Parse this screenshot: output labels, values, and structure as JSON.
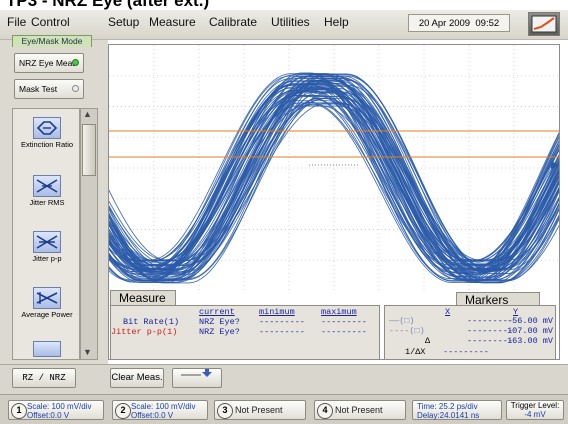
{
  "window": {
    "title_fragment": "TP3 - NRZ Eye (after ext.)"
  },
  "menu": {
    "items": [
      "File",
      "Control",
      "Setup",
      "Measure",
      "Calibrate",
      "Utilities",
      "Help"
    ],
    "date": "20 Apr 2009",
    "time": "09:52"
  },
  "left_panel": {
    "mode_tab": "Eye/Mask Mode",
    "nrz_button": "NRZ Eye Meas",
    "mask_button": "Mask Test",
    "meas_items": [
      "Extinction Ratio",
      "Jitter RMS",
      "Jitter p-p",
      "Average Power"
    ]
  },
  "measure_panel": {
    "tab_label": "Measure",
    "headers": [
      "current",
      "minimum",
      "maximum"
    ],
    "rows": [
      {
        "label": "Bit Rate(1)",
        "current": "NRZ Eye?",
        "minimum": "---------",
        "maximum": "---------",
        "color": "#1a24a0"
      },
      {
        "label": "Jitter p-p(1)",
        "current": "NRZ Eye?",
        "minimum": "---------",
        "maximum": "---------",
        "color": "#d21a1a"
      }
    ]
  },
  "markers_panel": {
    "tab_label": "Markers",
    "col_x": "X",
    "col_y": "Y",
    "rows": [
      {
        "x": "---------",
        "y": "-56.00 mV"
      },
      {
        "x": "---------",
        "y": "107.00 mV"
      },
      {
        "delta": "Δ",
        "x": "---------",
        "y": "163.00 mV"
      }
    ],
    "inv_label": "1/ΔX",
    "inv_value": "---------"
  },
  "controls": {
    "rz_nrz": "RZ / NRZ",
    "clear_meas": "Clear Meas."
  },
  "status_bar": {
    "channels": [
      {
        "num": "1",
        "scale": "Scale: 100 mV/div",
        "offset": "Offset:0.0 V"
      },
      {
        "num": "2",
        "scale": "Scale: 100 mV/div",
        "offset": "Offset:0.0 V"
      },
      {
        "num": "3",
        "text": "Not Present"
      },
      {
        "num": "4",
        "text": "Not Present"
      }
    ],
    "time": "Time: 25.2 ps/div",
    "delay": "Delay:24.0141 ns",
    "trigger_label": "Trigger Level:",
    "trigger_value": "-4 mV"
  },
  "colors": {
    "trace": "#2a5aa8",
    "marker_line": "#e08020",
    "measure_blue": "#1a24a0",
    "measure_red": "#d21a1a"
  }
}
